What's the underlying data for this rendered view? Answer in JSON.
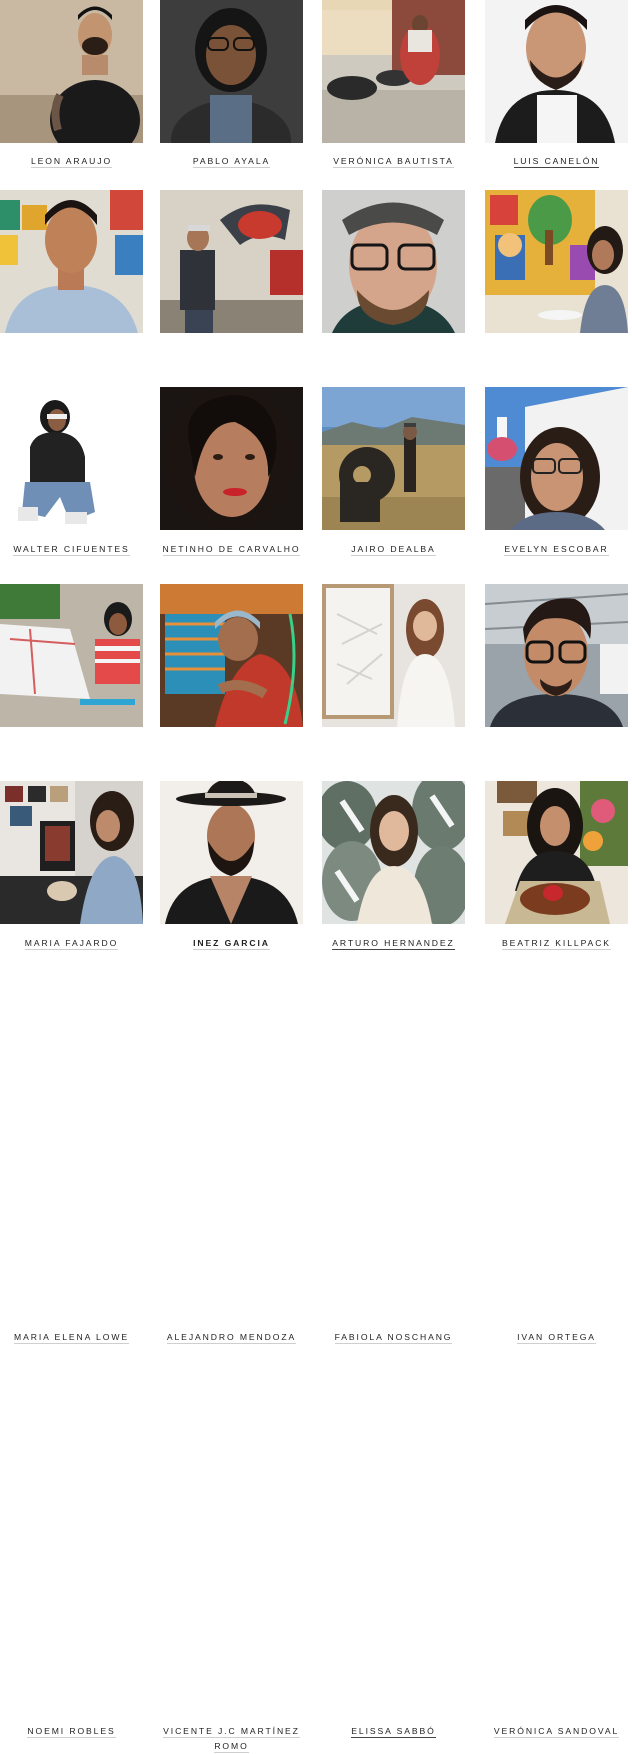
{
  "artists": [
    {
      "name": "LEON ARAUJO"
    },
    {
      "name": "PABLO AYALA"
    },
    {
      "name": "VERÓNICA BAUTISTA"
    },
    {
      "name": "LUIS CANELÓN"
    },
    {
      "name": "WALTER CIFUENTES"
    },
    {
      "name": "NETINHO DE CARVALHO"
    },
    {
      "name": "JAIRO DEALBA"
    },
    {
      "name": "EVELYN ESCOBAR"
    },
    {
      "name": "MARIA FAJARDO"
    },
    {
      "name": "INEZ GARCIA"
    },
    {
      "name": "ARTURO HERNANDEZ"
    },
    {
      "name": "BEATRIZ KILLPACK"
    },
    {
      "name": "MARIA ELENA LOWE"
    },
    {
      "name": "ALEJANDRO MENDOZA"
    },
    {
      "name": "FABIOLA NOSCHANG"
    },
    {
      "name": "IVAN ORTEGA"
    },
    {
      "name": "NOEMI ROBLES"
    },
    {
      "name_line1": "VICENTE J.C MARTÍNEZ",
      "name_line2": "ROMO"
    },
    {
      "name": "ELISSA SABBÓ"
    },
    {
      "name": "VERÓNICA SANDOVAL"
    }
  ]
}
